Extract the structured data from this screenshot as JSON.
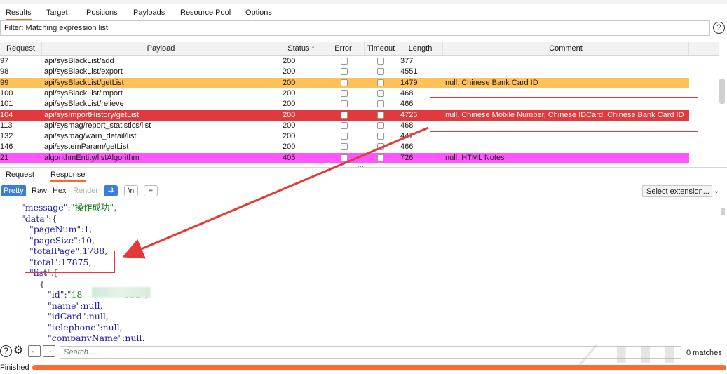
{
  "tabs": [
    "Results",
    "Target",
    "Positions",
    "Payloads",
    "Resource Pool",
    "Options"
  ],
  "filter": {
    "text": "Filter: Matching expression list"
  },
  "table": {
    "headers": [
      "Request",
      "Payload",
      "Status",
      "Error",
      "Timeout",
      "Length",
      "Comment"
    ],
    "status_sort_indicator": "^",
    "rows": [
      {
        "request": "97",
        "payload": "api/sysBlackList/add",
        "status": "200",
        "length": "377",
        "comment": ""
      },
      {
        "request": "98",
        "payload": "api/sysBlackList/export",
        "status": "200",
        "length": "4551",
        "comment": ""
      },
      {
        "request": "99",
        "payload": "api/sysBlackList/getList",
        "status": "200",
        "length": "1479",
        "comment": "null, Chinese Bank Card ID",
        "highlight": "#ffc15a"
      },
      {
        "request": "100",
        "payload": "api/sysBlackList/import",
        "status": "200",
        "length": "468",
        "comment": ""
      },
      {
        "request": "101",
        "payload": "api/sysBlackList/relieve",
        "status": "200",
        "length": "466",
        "comment": ""
      },
      {
        "request": "104",
        "payload": "api/sysImportHistory/getList",
        "status": "200",
        "length": "4725",
        "comment": "null, Chinese Mobile Number, Chinese IDCard, Chinese Bank Card ID",
        "highlight": "#e0393e",
        "text_color": "#ffffff"
      },
      {
        "request": "113",
        "payload": "api/sysmag/report_statistics/list",
        "status": "200",
        "length": "468",
        "comment": ""
      },
      {
        "request": "132",
        "payload": "api/sysmag/warn_detail/list",
        "status": "200",
        "length": "447",
        "comment": ""
      },
      {
        "request": "146",
        "payload": "api/systemParam/getList",
        "status": "200",
        "length": "466",
        "comment": ""
      },
      {
        "request": "21",
        "payload": "algorithmEntity/listAlgorithm",
        "status": "405",
        "length": "726",
        "comment": "null, HTML Notes",
        "highlight": "#ff55ff"
      }
    ]
  },
  "subtabs": [
    "Request",
    "Response"
  ],
  "viewbar": {
    "buttons": [
      "Pretty",
      "Raw",
      "Hex",
      "Render"
    ],
    "icon_wrap": "⇉",
    "icon_newline": "\\n",
    "icon_menu": "≡",
    "select_label": "Select extension...",
    "select_chevron": "⌄"
  },
  "code_lines": [
    {
      "indent": 0,
      "key": "message",
      "value": "\"操作成功\"",
      "vtype": "s"
    },
    {
      "indent": 0,
      "key": "data",
      "value": "{",
      "vtype": "p"
    },
    {
      "indent": 1,
      "key": "pageNum",
      "value": "1",
      "vtype": "n"
    },
    {
      "indent": 1,
      "key": "pageSize",
      "value": "10",
      "vtype": "n"
    },
    {
      "indent": 1,
      "key": "totalPage",
      "value": "1788",
      "vtype": "n"
    },
    {
      "indent": 1,
      "key": "total",
      "value": "17875",
      "vtype": "n"
    },
    {
      "indent": 1,
      "key": "list",
      "value": "[",
      "vtype": "p"
    },
    {
      "indent": 2,
      "key": "",
      "value": "{",
      "vtype": "p"
    },
    {
      "indent": 3,
      "key": "id",
      "value": "\"18               593\"",
      "vtype": "s"
    },
    {
      "indent": 3,
      "key": "name",
      "value": "null",
      "vtype": "n"
    },
    {
      "indent": 3,
      "key": "idCard",
      "value": "null",
      "vtype": "n"
    },
    {
      "indent": 3,
      "key": "telephone",
      "value": "null",
      "vtype": "n"
    },
    {
      "indent": 3,
      "key": "companyName",
      "value": "null",
      "vtype": "n"
    }
  ],
  "search": {
    "placeholder": "Search...",
    "matches": "0 matches"
  },
  "status": {
    "text": "Finished"
  },
  "colors": {
    "accent": "#ff6633",
    "annotation": "#e53935"
  }
}
